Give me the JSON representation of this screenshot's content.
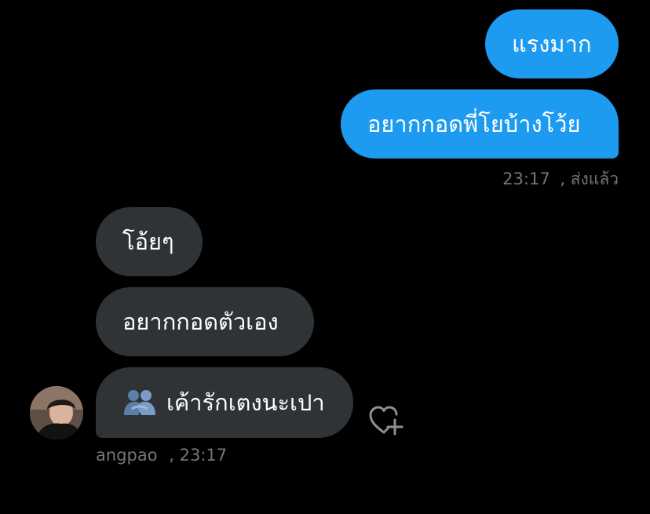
{
  "conversation": {
    "sent_messages": [
      {
        "text": "แรงมาก"
      },
      {
        "text": "อยากกอดพี่โยบ้างโว้ย"
      }
    ],
    "sent_meta": {
      "time": "23:17",
      "status": ", ส่งแล้ว"
    },
    "received_messages": [
      {
        "text": "โอ้ยๆ"
      },
      {
        "text": "อยากกอดตัวเอง"
      },
      {
        "text": "เค้ารักเตงนะเปา",
        "emoji": "people-hugging-emoji"
      }
    ],
    "received_meta": {
      "sender": "angpao",
      "time": ", 23:17"
    }
  },
  "icons": {
    "react": "heart-plus-icon",
    "avatar": "user-avatar"
  },
  "colors": {
    "background": "#000000",
    "sent_bubble": "#1d9bf0",
    "received_bubble": "#2f3336",
    "meta_text": "#71767b"
  }
}
